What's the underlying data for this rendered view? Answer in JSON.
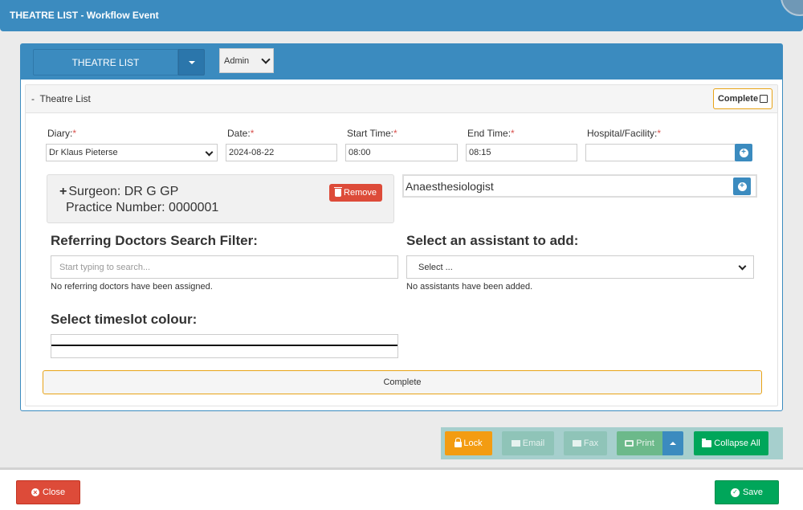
{
  "window": {
    "title": "THEATRE LIST - Workflow Event"
  },
  "header": {
    "theatre_list_label": "THEATRE LIST",
    "user_select": "Admin"
  },
  "section": {
    "toggle": "-",
    "label": "Theatre List",
    "complete_label": "Complete"
  },
  "fields": {
    "diary": {
      "label": "Diary:",
      "required": "*",
      "value": "Dr Klaus Pieterse"
    },
    "date": {
      "label": "Date:",
      "required": "*",
      "value": "2024-08-22"
    },
    "start_time": {
      "label": "Start Time:",
      "required": "*",
      "value": "08:00"
    },
    "end_time": {
      "label": "End Time:",
      "required": "*",
      "value": "08:15"
    },
    "hospital": {
      "label": "Hospital/Facility:",
      "required": "*",
      "value": ""
    }
  },
  "surgeon": {
    "plus": "+",
    "name_line": "Surgeon: DR G GP",
    "practice_line": "Practice Number: 0000001",
    "remove_label": "Remove"
  },
  "anaesthesiologist": {
    "label": "Anaesthesiologist"
  },
  "referring": {
    "heading": "Referring Doctors Search Filter:",
    "placeholder": "Start typing to search...",
    "help": "No referring doctors have been assigned."
  },
  "assistant": {
    "heading": "Select an assistant to add:",
    "selected": "Select ...",
    "help": "No assistants have been added."
  },
  "timeslot": {
    "heading": "Select timeslot colour:",
    "colour": "#111111"
  },
  "complete_bar": {
    "label": "Complete"
  },
  "toolbar": {
    "lock": "Lock",
    "email": "Email",
    "fax": "Fax",
    "print": "Print",
    "collapse_all": "Collapse All"
  },
  "footer": {
    "close": "Close",
    "save": "Save"
  },
  "colors": {
    "primary": "#3b8bbf",
    "danger": "#dd4b39",
    "success": "#00a65a",
    "warning": "#f39c12"
  }
}
